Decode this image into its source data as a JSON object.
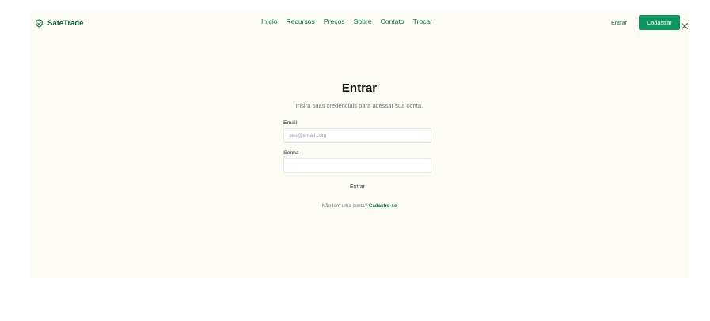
{
  "brand": {
    "name": "SafeTrade",
    "icon": "shield-icon",
    "color": "#0a6b47"
  },
  "nav": {
    "items": [
      {
        "label": "Início"
      },
      {
        "label": "Recursos"
      },
      {
        "label": "Preços"
      },
      {
        "label": "Sobre"
      },
      {
        "label": "Contato"
      },
      {
        "label": "Trocar"
      }
    ]
  },
  "header_actions": {
    "login_label": "Entrar",
    "signup_label": "Cadastrar",
    "close_icon": "close-icon",
    "accent_color": "#10935f"
  },
  "login_form": {
    "title": "Entrar",
    "subtitle": "Insira suas credenciais para acessar sua conta.",
    "email": {
      "label": "Email",
      "placeholder": "seu@email.com",
      "value": ""
    },
    "password": {
      "label": "Senha",
      "placeholder": "",
      "value": ""
    },
    "submit_label": "Entrar",
    "signup_prompt": "Não tem uma conta?",
    "signup_link": "Cadastre-se"
  }
}
